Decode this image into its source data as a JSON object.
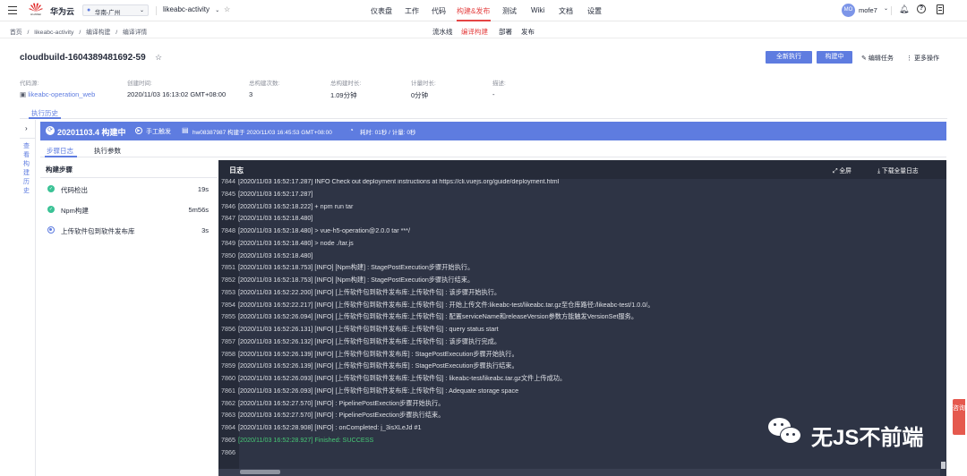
{
  "topbar": {
    "brand": "华为云",
    "brand_sub": "HUAWEI",
    "region": "华南-广州",
    "project": "likeabc-activity",
    "menu": [
      "仪表盘",
      "工作",
      "代码",
      "构建&发布",
      "测试",
      "Wiki",
      "文档",
      "设置"
    ],
    "active_menu": "构建&发布",
    "avatar": "MO",
    "username": "mofe7"
  },
  "breadcrumb": [
    "首页",
    "likeabc-activity",
    "编译构建",
    "编译详情"
  ],
  "subnav": [
    "流水线",
    "编译构建",
    "部署",
    "发布"
  ],
  "active_subnav": "编译构建",
  "title": "cloudbuild-1604389481692-59",
  "actions": {
    "run_all": "全新执行",
    "building": "构建中",
    "edit": "编辑任务",
    "more": "更多操作"
  },
  "meta": [
    {
      "label": "代码源:",
      "value": "likeabc-operation_web"
    },
    {
      "label": "创建时间:",
      "value": "2020/11/03 16:13:02 GMT+08:00"
    },
    {
      "label": "总构建次数:",
      "value": "3"
    },
    {
      "label": "总构建时长:",
      "value": "1.09分钟"
    },
    {
      "label": "计量时长:",
      "value": "0分钟"
    },
    {
      "label": "描述:",
      "value": "-"
    }
  ],
  "history_tab": "执行历史",
  "side_label": "查看构建历史",
  "run": {
    "id": "20201103.4 构建中",
    "trigger": "手工触发",
    "commit": "hw08387987 构建于 2020/11/03 16:45:53 GMT+08:00",
    "duration": "耗时: 01秒 / 计量: 0秒"
  },
  "tabs": [
    "步骤日志",
    "执行参数"
  ],
  "steps_title": "构建步骤",
  "steps": [
    {
      "name": "代码检出",
      "duration": "19s",
      "status": "success"
    },
    {
      "name": "Npm构建",
      "duration": "5m56s",
      "status": "success"
    },
    {
      "name": "上传软件包到软件发布库",
      "duration": "3s",
      "status": "running"
    }
  ],
  "log": {
    "title": "日志",
    "fullscreen": "全屏",
    "download": "下载全量日志",
    "lines": [
      {
        "n": "7844",
        "t": "[2020/11/03 16:52:17.287]  INFO  Check out deployment instructions at https://cli.vuejs.org/guide/deployment.html"
      },
      {
        "n": "7845",
        "t": "[2020/11/03 16:52:17.287]"
      },
      {
        "n": "7846",
        "t": "[2020/11/03 16:52:18.222] + npm run tar"
      },
      {
        "n": "7847",
        "t": "[2020/11/03 16:52:18.480]"
      },
      {
        "n": "7848",
        "t": "[2020/11/03 16:52:18.480] > vue-h5-operation@2.0.0 tar ***/"
      },
      {
        "n": "7849",
        "t": "[2020/11/03 16:52:18.480] > node ./tar.js"
      },
      {
        "n": "7850",
        "t": "[2020/11/03 16:52:18.480]"
      },
      {
        "n": "7851",
        "t": "[2020/11/03 16:52:18.753] [INFO] [Npm构建] : StagePostExecution步骤开始执行。"
      },
      {
        "n": "7852",
        "t": "[2020/11/03 16:52:18.753] [INFO] [Npm构建] : StagePostExecution步骤执行结束。"
      },
      {
        "n": "7853",
        "t": "[2020/11/03 16:52:22.200] [INFO] [上传软件包到软件发布库:上传软件包] : 该步骤开始执行。"
      },
      {
        "n": "7854",
        "t": "[2020/11/03 16:52:22.217] [INFO] [上传软件包到软件发布库:上传软件包] : 开始上传文件:likeabc-test/likeabc.tar.gz至仓库路径:/likeabc-test/1.0.0/。"
      },
      {
        "n": "7855",
        "t": "[2020/11/03 16:52:26.094] [INFO] [上传软件包到软件发布库:上传软件包] : 配置serviceName和releaseVersion参数方能触发VersionSet服务。"
      },
      {
        "n": "7856",
        "t": "[2020/11/03 16:52:26.131] [INFO] [上传软件包到软件发布库:上传软件包] : query status start"
      },
      {
        "n": "7857",
        "t": "[2020/11/03 16:52:26.132] [INFO] [上传软件包到软件发布库:上传软件包] : 该步骤执行完成。"
      },
      {
        "n": "7858",
        "t": "[2020/11/03 16:52:26.139] [INFO] [上传软件包到软件发布库] : StagePostExecution步骤开始执行。"
      },
      {
        "n": "7859",
        "t": "[2020/11/03 16:52:26.139] [INFO] [上传软件包到软件发布库] : StagePostExecution步骤执行结束。"
      },
      {
        "n": "7860",
        "t": "[2020/11/03 16:52:26.093] [INFO] [上传软件包到软件发布库:上传软件包] : likeabc-test/likeabc.tar.gz文件上传成功。"
      },
      {
        "n": "7861",
        "t": "[2020/11/03 16:52:26.093] [INFO] [上传软件包到软件发布库:上传软件包] : Adequate storage space"
      },
      {
        "n": "7862",
        "t": "[2020/11/03 16:52:27.570] [INFO]  : PipelinePostExection步骤开始执行。"
      },
      {
        "n": "7863",
        "t": "[2020/11/03 16:52:27.570] [INFO]  : PipelinePostExection步骤执行结束。"
      },
      {
        "n": "7864",
        "t": "[2020/11/03 16:52:28.908] [INFO]  : onCompleted: j_3isXLeJd #1"
      },
      {
        "n": "7865",
        "t": "[2020/11/03 16:52:28.927] Finished: SUCCESS"
      },
      {
        "n": "7866",
        "t": ""
      }
    ]
  },
  "watermark": "无JS不前端",
  "feedback": "咨询",
  "colors": {
    "accent": "#5e7ce0",
    "success": "#3ac295",
    "log_bg": "#2e3445",
    "active_red": "#e54545",
    "finish_green": "#47c775"
  }
}
